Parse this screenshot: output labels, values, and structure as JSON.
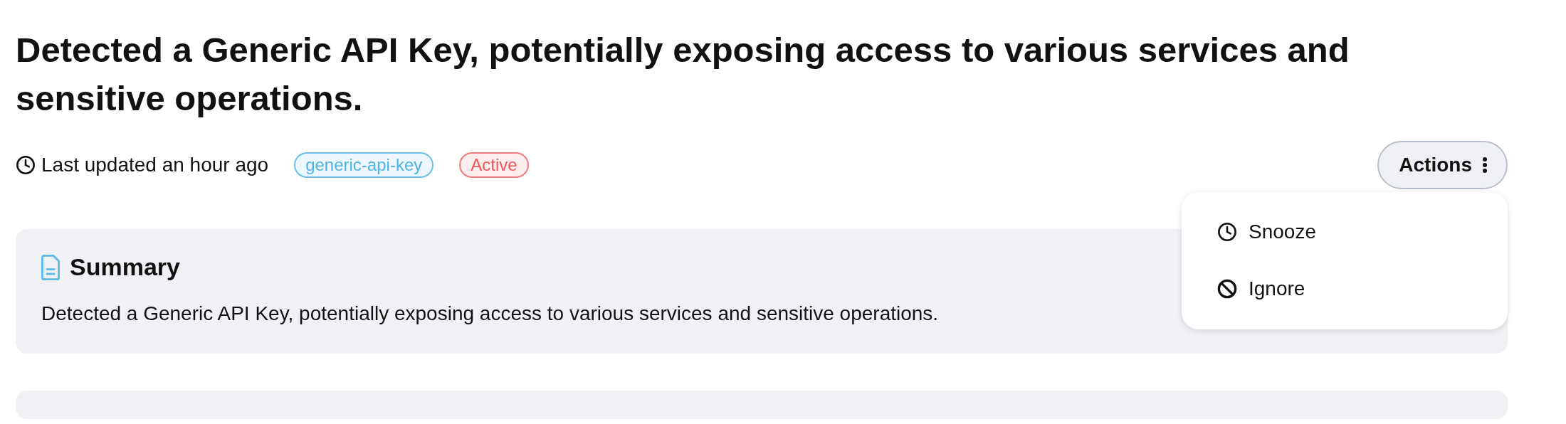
{
  "title": "Detected a Generic API Key, potentially exposing access to various services and sensitive operations.",
  "meta": {
    "updated": "Last updated an hour ago",
    "tags": [
      {
        "label": "generic-api-key",
        "kind": "rule"
      },
      {
        "label": "Active",
        "kind": "status"
      }
    ]
  },
  "actions": {
    "label": "Actions",
    "expanded": true,
    "items": [
      {
        "label": "Snooze",
        "kind": "snooze"
      },
      {
        "label": "Ignore",
        "kind": "ignore"
      }
    ]
  },
  "summary": {
    "heading": "Summary",
    "text": "Detected a Generic API Key, potentially exposing access to various services and sensitive operations."
  }
}
